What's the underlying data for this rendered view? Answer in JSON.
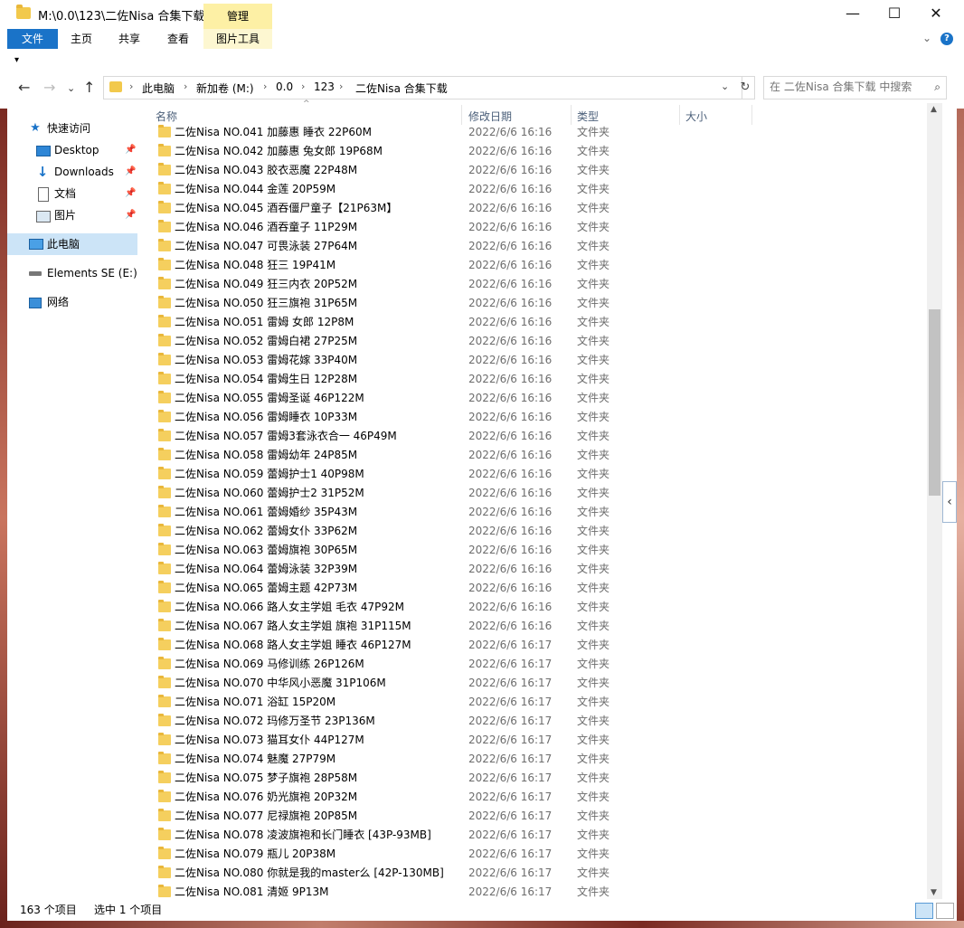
{
  "window": {
    "title": "M:\\0.0\\123\\二佐Nisa 合集下载",
    "manage_tab": "管理",
    "minimize": "—",
    "maximize": "☐",
    "close": "✕"
  },
  "ribbon": {
    "tabs": [
      "文件",
      "主页",
      "共享",
      "查看",
      "图片工具"
    ],
    "expand": "⌄",
    "help": "?"
  },
  "quick_access_toolbar": "▾",
  "address": {
    "back": "←",
    "forward": "→",
    "recent": "⌄",
    "up": "↑",
    "crumbs": [
      "此电脑",
      "新加卷 (M:)",
      "0.0",
      "123",
      "二佐Nisa 合集下载"
    ],
    "separator": "›",
    "dropdown": "⌄",
    "refresh": "↻",
    "search_placeholder": "在 二佐Nisa 合集下载 中搜索",
    "search_icon": "⌕"
  },
  "nav": {
    "items": [
      {
        "label": "快速访问",
        "icon": "star-icon"
      },
      {
        "label": "Desktop",
        "icon": "desktop-icon",
        "pin": true
      },
      {
        "label": "Downloads",
        "icon": "download-arrow-icon",
        "pin": true
      },
      {
        "label": "文档",
        "icon": "document-icon",
        "pin": true
      },
      {
        "label": "图片",
        "icon": "picture-icon",
        "pin": true
      },
      {
        "label": "此电脑",
        "icon": "computer-icon",
        "selected": true
      },
      {
        "label": "Elements SE (E:)",
        "icon": "drive-icon"
      },
      {
        "label": "网络",
        "icon": "network-icon"
      }
    ],
    "pin_glyph": "📌"
  },
  "columns": {
    "name": "名称",
    "modified": "修改日期",
    "type": "类型",
    "size": "大小",
    "sort_indicator": "^"
  },
  "files": [
    {
      "name": "二佐Nisa NO.041 加藤惠 睡衣 22P60M",
      "date": "2022/6/6 16:16",
      "type": "文件夹"
    },
    {
      "name": "二佐Nisa NO.042 加藤惠 兔女郎 19P68M",
      "date": "2022/6/6 16:16",
      "type": "文件夹"
    },
    {
      "name": "二佐Nisa NO.043 胶衣恶魔 22P48M",
      "date": "2022/6/6 16:16",
      "type": "文件夹"
    },
    {
      "name": "二佐Nisa NO.044 金莲 20P59M",
      "date": "2022/6/6 16:16",
      "type": "文件夹"
    },
    {
      "name": "二佐Nisa NO.045 酒吞僵尸童子【21P63M】",
      "date": "2022/6/6 16:16",
      "type": "文件夹"
    },
    {
      "name": "二佐Nisa NO.046 酒吞童子 11P29M",
      "date": "2022/6/6 16:16",
      "type": "文件夹"
    },
    {
      "name": "二佐Nisa NO.047 可畏泳装 27P64M",
      "date": "2022/6/6 16:16",
      "type": "文件夹"
    },
    {
      "name": "二佐Nisa NO.048 狂三 19P41M",
      "date": "2022/6/6 16:16",
      "type": "文件夹"
    },
    {
      "name": "二佐Nisa NO.049 狂三内衣 20P52M",
      "date": "2022/6/6 16:16",
      "type": "文件夹"
    },
    {
      "name": "二佐Nisa NO.050 狂三旗袍 31P65M",
      "date": "2022/6/6 16:16",
      "type": "文件夹"
    },
    {
      "name": "二佐Nisa NO.051 雷姆 女郎 12P8M",
      "date": "2022/6/6 16:16",
      "type": "文件夹"
    },
    {
      "name": "二佐Nisa NO.052 雷姆白裙 27P25M",
      "date": "2022/6/6 16:16",
      "type": "文件夹"
    },
    {
      "name": "二佐Nisa NO.053 雷姆花嫁 33P40M",
      "date": "2022/6/6 16:16",
      "type": "文件夹"
    },
    {
      "name": "二佐Nisa NO.054 雷姆生日 12P28M",
      "date": "2022/6/6 16:16",
      "type": "文件夹"
    },
    {
      "name": "二佐Nisa NO.055 雷姆圣诞 46P122M",
      "date": "2022/6/6 16:16",
      "type": "文件夹"
    },
    {
      "name": "二佐Nisa NO.056 雷姆睡衣 10P33M",
      "date": "2022/6/6 16:16",
      "type": "文件夹"
    },
    {
      "name": "二佐Nisa NO.057 雷姆3套泳衣合一 46P49M",
      "date": "2022/6/6 16:16",
      "type": "文件夹"
    },
    {
      "name": "二佐Nisa NO.058 雷姆幼年 24P85M",
      "date": "2022/6/6 16:16",
      "type": "文件夹"
    },
    {
      "name": "二佐Nisa NO.059 蕾姆护士1 40P98M",
      "date": "2022/6/6 16:16",
      "type": "文件夹"
    },
    {
      "name": "二佐Nisa NO.060 蕾姆护士2 31P52M",
      "date": "2022/6/6 16:16",
      "type": "文件夹"
    },
    {
      "name": "二佐Nisa NO.061 蕾姆婚纱 35P43M",
      "date": "2022/6/6 16:16",
      "type": "文件夹"
    },
    {
      "name": "二佐Nisa NO.062 蕾姆女仆 33P62M",
      "date": "2022/6/6 16:16",
      "type": "文件夹"
    },
    {
      "name": "二佐Nisa NO.063 蕾姆旗袍 30P65M",
      "date": "2022/6/6 16:16",
      "type": "文件夹"
    },
    {
      "name": "二佐Nisa NO.064 蕾姆泳装 32P39M",
      "date": "2022/6/6 16:16",
      "type": "文件夹"
    },
    {
      "name": "二佐Nisa NO.065 蕾姆主题 42P73M",
      "date": "2022/6/6 16:16",
      "type": "文件夹"
    },
    {
      "name": "二佐Nisa NO.066 路人女主学姐 毛衣 47P92M",
      "date": "2022/6/6 16:16",
      "type": "文件夹"
    },
    {
      "name": "二佐Nisa NO.067 路人女主学姐 旗袍 31P115M",
      "date": "2022/6/6 16:16",
      "type": "文件夹"
    },
    {
      "name": "二佐Nisa NO.068 路人女主学姐 睡衣 46P127M",
      "date": "2022/6/6 16:17",
      "type": "文件夹"
    },
    {
      "name": "二佐Nisa NO.069 马修训练 26P126M",
      "date": "2022/6/6 16:17",
      "type": "文件夹"
    },
    {
      "name": "二佐Nisa NO.070 中华风小恶魔 31P106M",
      "date": "2022/6/6 16:17",
      "type": "文件夹"
    },
    {
      "name": "二佐Nisa NO.071 浴缸 15P20M",
      "date": "2022/6/6 16:17",
      "type": "文件夹"
    },
    {
      "name": "二佐Nisa NO.072 玛修万圣节 23P136M",
      "date": "2022/6/6 16:17",
      "type": "文件夹"
    },
    {
      "name": "二佐Nisa NO.073 猫耳女仆 44P127M",
      "date": "2022/6/6 16:17",
      "type": "文件夹"
    },
    {
      "name": "二佐Nisa NO.074 魅魔 27P79M",
      "date": "2022/6/6 16:17",
      "type": "文件夹"
    },
    {
      "name": "二佐Nisa NO.075 梦子旗袍 28P58M",
      "date": "2022/6/6 16:17",
      "type": "文件夹"
    },
    {
      "name": "二佐Nisa NO.076 奶光旗袍 20P32M",
      "date": "2022/6/6 16:17",
      "type": "文件夹"
    },
    {
      "name": "二佐Nisa NO.077 尼禄旗袍 20P85M",
      "date": "2022/6/6 16:17",
      "type": "文件夹"
    },
    {
      "name": "二佐Nisa NO.078 凌波旗袍和长门睡衣 [43P-93MB]",
      "date": "2022/6/6 16:17",
      "type": "文件夹"
    },
    {
      "name": "二佐Nisa NO.079 瓶儿 20P38M",
      "date": "2022/6/6 16:17",
      "type": "文件夹"
    },
    {
      "name": "二佐Nisa NO.080 你就是我的master么 [42P-130MB]",
      "date": "2022/6/6 16:17",
      "type": "文件夹"
    },
    {
      "name": "二佐Nisa NO.081 清姬 9P13M",
      "date": "2022/6/6 16:17",
      "type": "文件夹"
    }
  ],
  "scrollbar": {
    "up": "▲",
    "down": "▼",
    "side_toggle": "‹"
  },
  "status": {
    "count": "163 个项目",
    "selected": "选中 1 个项目"
  }
}
